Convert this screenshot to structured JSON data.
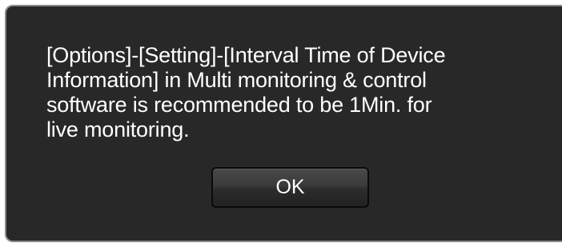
{
  "dialog": {
    "message": "[Options]-[Setting]-[Interval Time of Device\nInformation] in Multi monitoring & control\nsoftware is recommended to be 1Min. for\nlive monitoring.",
    "ok_label": "OK"
  },
  "colors": {
    "dialog_background": "#282828",
    "dialog_border": "#8a8a8a",
    "text": "#ffffff",
    "button_dark": "#2c2c2c"
  }
}
